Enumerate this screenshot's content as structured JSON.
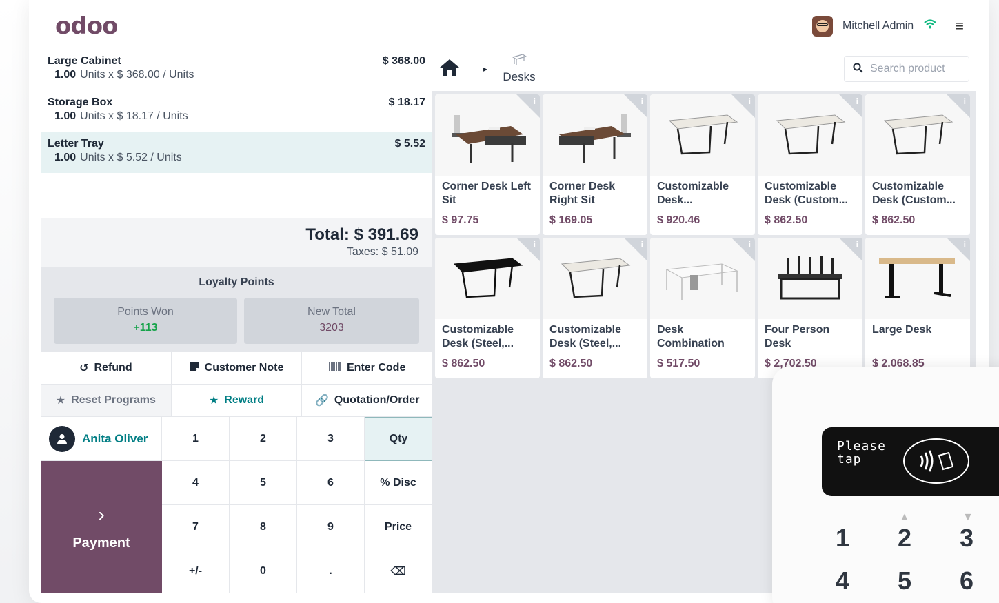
{
  "header": {
    "logo": "odoo",
    "user_name": "Mitchell Admin"
  },
  "orderlines": [
    {
      "name": "Large Cabinet",
      "price": "$ 368.00",
      "qty": "1.00",
      "detail": "Units x $ 368.00 / Units"
    },
    {
      "name": "Storage Box",
      "price": "$ 18.17",
      "qty": "1.00",
      "detail": "Units x $ 18.17 / Units"
    },
    {
      "name": "Letter Tray",
      "price": "$ 5.52",
      "qty": "1.00",
      "detail": "Units x $ 5.52 / Units"
    }
  ],
  "totals": {
    "total": "Total: $ 391.69",
    "taxes": "Taxes: $ 51.09"
  },
  "loyalty": {
    "title": "Loyalty Points",
    "won_label": "Points Won",
    "won_value": "+113",
    "new_total_label": "New Total",
    "new_total_value": "3203"
  },
  "controls": {
    "refund": "Refund",
    "customer_note": "Customer Note",
    "enter_code": "Enter Code",
    "reset_programs": "Reset Programs",
    "reward": "Reward",
    "quotation_order": "Quotation/Order"
  },
  "customer": {
    "name": "Anita Oliver"
  },
  "payment": {
    "label": "Payment"
  },
  "numpad": [
    "1",
    "2",
    "3",
    "Qty",
    "4",
    "5",
    "6",
    "% Disc",
    "7",
    "8",
    "9",
    "Price",
    "+/-",
    "0",
    ".",
    "⌫"
  ],
  "breadcrumb": {
    "category": "Desks"
  },
  "search": {
    "placeholder": "Search product"
  },
  "products": [
    {
      "name": "Corner Desk Left Sit",
      "price": "$ 97.75"
    },
    {
      "name": "Corner Desk Right Sit",
      "price": "$ 169.05"
    },
    {
      "name": "Customizable Desk...",
      "price": "$ 920.46"
    },
    {
      "name": "Customizable Desk (Custom...",
      "price": "$ 862.50"
    },
    {
      "name": "Customizable Desk (Custom...",
      "price": "$ 862.50"
    },
    {
      "name": "Customizable Desk (Steel,...",
      "price": "$ 862.50"
    },
    {
      "name": "Customizable Desk (Steel,...",
      "price": "$ 862.50"
    },
    {
      "name": "Desk Combination",
      "price": "$ 517.50"
    },
    {
      "name": "Four Person Desk",
      "price": "$ 2,702.50"
    },
    {
      "name": "Large Desk",
      "price": "$ 2,068.85"
    }
  ],
  "terminal": {
    "line1": "Please",
    "line2": "tap",
    "keys": [
      "1",
      "2",
      "3",
      "4",
      "5",
      "6"
    ]
  },
  "colors": {
    "brand": "#714b67",
    "teal": "#017e84",
    "green": "#16a34a"
  }
}
